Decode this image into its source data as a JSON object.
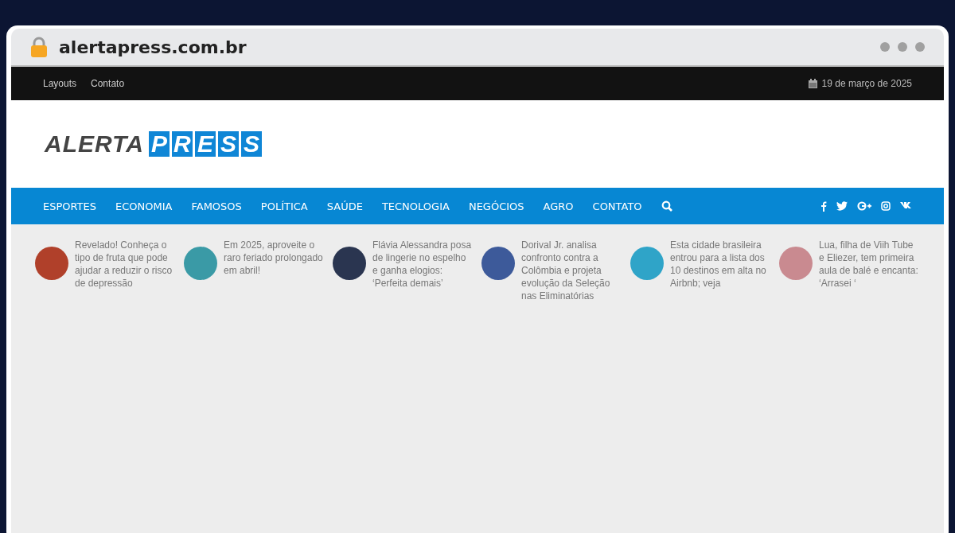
{
  "browser": {
    "address": "alertapress.com.br"
  },
  "top_bar": {
    "links": [
      "Layouts",
      "Contato"
    ],
    "date": "19 de março de 2025"
  },
  "logo": {
    "part_1": "ALERTA",
    "part_2": "PRESS"
  },
  "nav": {
    "items": [
      "ESPORTES",
      "ECONOMIA",
      "FAMOSOS",
      "POLÍTICA",
      "SAÚDE",
      "TECNOLOGIA",
      "NEGÓCIOS",
      "AGRO",
      "CONTATO"
    ]
  },
  "news": [
    {
      "title": "Revelado! Conheça o tipo de fruta que pode ajudar a reduzir o risco de depressão",
      "color": "#b0402a"
    },
    {
      "title": "Em 2025, aproveite o raro feriado prolongado em abril!",
      "color": "#3a9aa6"
    },
    {
      "title": "Flávia Alessandra posa de lingerie no espelho e ganha elogios: ‘Perfeita demais’",
      "color": "#2a3550"
    },
    {
      "title": "Dorival Jr. analisa confronto contra a Colômbia e projeta evolução da Seleção nas Eliminatórias",
      "color": "#3d5a9a"
    },
    {
      "title": "Esta cidade brasileira entrou para a lista dos 10 destinos em alta no Airbnb; veja",
      "color": "#2fa4c8"
    },
    {
      "title": "Lua, filha de Viih Tube e Eliezer, tem primeira aula de balé e encanta: ‘Arrasei ‘",
      "color": "#c98a90"
    }
  ]
}
